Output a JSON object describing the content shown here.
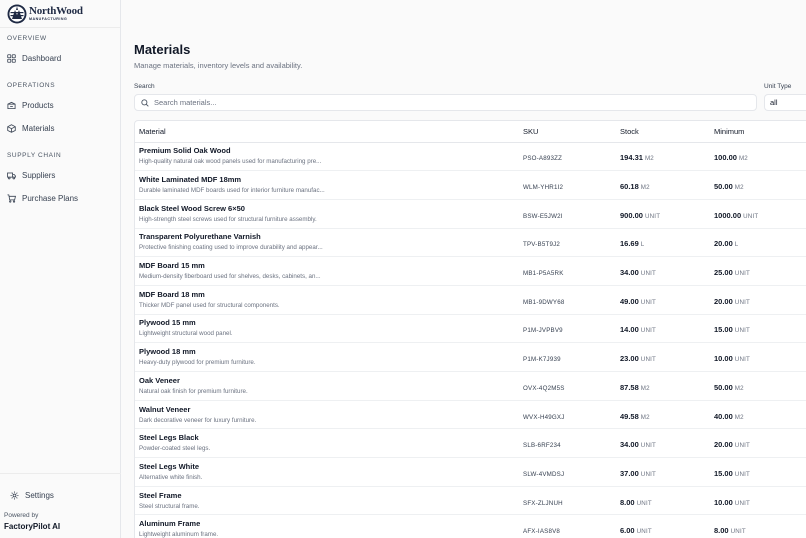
{
  "brand": {
    "name": "NorthWood",
    "tagline": "MANUFACTURING",
    "powered_label": "Powered by",
    "powered_brand": "FactoryPilot AI"
  },
  "sidebar": {
    "sections": [
      {
        "heading": "OVERVIEW",
        "items": [
          {
            "label": "Dashboard",
            "icon": "dashboard-icon"
          }
        ]
      },
      {
        "heading": "OPERATIONS",
        "items": [
          {
            "label": "Products",
            "icon": "box-icon"
          },
          {
            "label": "Materials",
            "icon": "package-icon"
          }
        ]
      },
      {
        "heading": "SUPPLY CHAIN",
        "items": [
          {
            "label": "Suppliers",
            "icon": "truck-icon"
          },
          {
            "label": "Purchase Plans",
            "icon": "cart-icon"
          }
        ]
      }
    ],
    "settings_label": "Settings"
  },
  "page": {
    "title": "Materials",
    "subtitle": "Manage materials, inventory levels and availability."
  },
  "filters": {
    "search_label": "Search",
    "search_placeholder": "Search materials...",
    "unit_label": "Unit Type",
    "unit_value": "all"
  },
  "table": {
    "columns": [
      "Material",
      "SKU",
      "Stock",
      "Minimum"
    ],
    "rows": [
      {
        "name": "Premium Solid Oak Wood",
        "desc": "High-quality natural oak wood panels used for manufacturing pre...",
        "sku": "PSO-A893ZZ",
        "stock": "194.31",
        "stock_unit": "M2",
        "min": "100.00",
        "min_unit": "M2"
      },
      {
        "name": "White Laminated MDF 18mm",
        "desc": "Durable laminated MDF boards used for interior furniture manufac...",
        "sku": "WLM-YHR1I2",
        "stock": "60.18",
        "stock_unit": "M2",
        "min": "50.00",
        "min_unit": "M2"
      },
      {
        "name": "Black Steel Wood Screw 6×50",
        "desc": "High-strength steel screws used for structural furniture assembly.",
        "sku": "BSW-E5JW2I",
        "stock": "900.00",
        "stock_unit": "UNIT",
        "min": "1000.00",
        "min_unit": "UNIT"
      },
      {
        "name": "Transparent Polyurethane Varnish",
        "desc": "Protective finishing coating used to improve durability and appear...",
        "sku": "TPV-B5T9J2",
        "stock": "16.69",
        "stock_unit": "L",
        "min": "20.00",
        "min_unit": "L"
      },
      {
        "name": "MDF Board 15 mm",
        "desc": "Medium-density fiberboard used for shelves, desks, cabinets, an...",
        "sku": "MB1-P5A5RK",
        "stock": "34.00",
        "stock_unit": "UNIT",
        "min": "25.00",
        "min_unit": "UNIT"
      },
      {
        "name": "MDF Board 18 mm",
        "desc": "Thicker MDF panel used for structural components.",
        "sku": "MB1-9DWY68",
        "stock": "49.00",
        "stock_unit": "UNIT",
        "min": "20.00",
        "min_unit": "UNIT"
      },
      {
        "name": "Plywood 15 mm",
        "desc": "Lightweight structural wood panel.",
        "sku": "P1M-JVPBV9",
        "stock": "14.00",
        "stock_unit": "UNIT",
        "min": "15.00",
        "min_unit": "UNIT"
      },
      {
        "name": "Plywood 18 mm",
        "desc": "Heavy-duty plywood for premium furniture.",
        "sku": "P1M-K7J939",
        "stock": "23.00",
        "stock_unit": "UNIT",
        "min": "10.00",
        "min_unit": "UNIT"
      },
      {
        "name": "Oak Veneer",
        "desc": "Natural oak finish for premium furniture.",
        "sku": "OVX-4Q2M5S",
        "stock": "87.58",
        "stock_unit": "M2",
        "min": "50.00",
        "min_unit": "M2"
      },
      {
        "name": "Walnut Veneer",
        "desc": "Dark decorative veneer for luxury furniture.",
        "sku": "WVX-H49GXJ",
        "stock": "49.58",
        "stock_unit": "M2",
        "min": "40.00",
        "min_unit": "M2"
      },
      {
        "name": "Steel Legs Black",
        "desc": "Powder-coated steel legs.",
        "sku": "SLB-6RF234",
        "stock": "34.00",
        "stock_unit": "UNIT",
        "min": "20.00",
        "min_unit": "UNIT"
      },
      {
        "name": "Steel Legs White",
        "desc": "Alternative white finish.",
        "sku": "SLW-4VMDSJ",
        "stock": "37.00",
        "stock_unit": "UNIT",
        "min": "15.00",
        "min_unit": "UNIT"
      },
      {
        "name": "Steel Frame",
        "desc": "Steel structural frame.",
        "sku": "SFX-ZLJNUH",
        "stock": "8.00",
        "stock_unit": "UNIT",
        "min": "10.00",
        "min_unit": "UNIT"
      },
      {
        "name": "Aluminum Frame",
        "desc": "Lightweight aluminum frame.",
        "sku": "AFX-IAS8V8",
        "stock": "6.00",
        "stock_unit": "UNIT",
        "min": "8.00",
        "min_unit": "UNIT"
      }
    ]
  },
  "colors": {
    "brand_navy": "#1f2a44",
    "text_primary": "#111827",
    "text_muted": "#6b7280",
    "border": "#e5e7eb",
    "background": "#fafafa"
  }
}
